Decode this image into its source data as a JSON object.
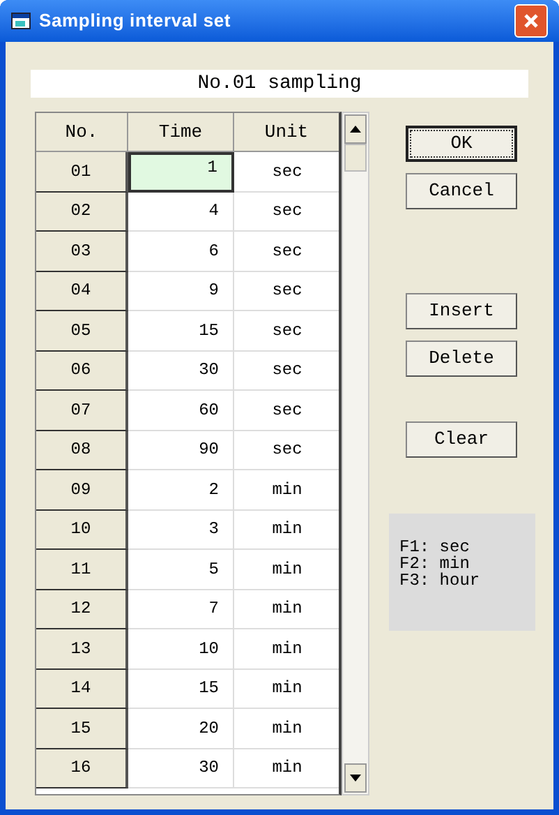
{
  "window": {
    "title": "Sampling interval set"
  },
  "heading": "No.01 sampling",
  "table": {
    "columns": [
      "No.",
      "Time",
      "Unit"
    ],
    "rows": [
      {
        "no": "01",
        "time": "1",
        "unit": "sec",
        "selected": true
      },
      {
        "no": "02",
        "time": "4",
        "unit": "sec",
        "selected": false
      },
      {
        "no": "03",
        "time": "6",
        "unit": "sec",
        "selected": false
      },
      {
        "no": "04",
        "time": "9",
        "unit": "sec",
        "selected": false
      },
      {
        "no": "05",
        "time": "15",
        "unit": "sec",
        "selected": false
      },
      {
        "no": "06",
        "time": "30",
        "unit": "sec",
        "selected": false
      },
      {
        "no": "07",
        "time": "60",
        "unit": "sec",
        "selected": false
      },
      {
        "no": "08",
        "time": "90",
        "unit": "sec",
        "selected": false
      },
      {
        "no": "09",
        "time": "2",
        "unit": "min",
        "selected": false
      },
      {
        "no": "10",
        "time": "3",
        "unit": "min",
        "selected": false
      },
      {
        "no": "11",
        "time": "5",
        "unit": "min",
        "selected": false
      },
      {
        "no": "12",
        "time": "7",
        "unit": "min",
        "selected": false
      },
      {
        "no": "13",
        "time": "10",
        "unit": "min",
        "selected": false
      },
      {
        "no": "14",
        "time": "15",
        "unit": "min",
        "selected": false
      },
      {
        "no": "15",
        "time": "20",
        "unit": "min",
        "selected": false
      },
      {
        "no": "16",
        "time": "30",
        "unit": "min",
        "selected": false
      }
    ]
  },
  "button_groups": [
    [
      {
        "label": "OK",
        "focused": true
      },
      {
        "label": "Cancel",
        "focused": false
      }
    ],
    [
      {
        "label": "Insert",
        "focused": false
      },
      {
        "label": "Delete",
        "focused": false
      }
    ],
    [
      {
        "label": "Clear",
        "focused": false
      }
    ]
  ],
  "help": [
    "F1: sec",
    "F2: min",
    "F3: hour"
  ]
}
